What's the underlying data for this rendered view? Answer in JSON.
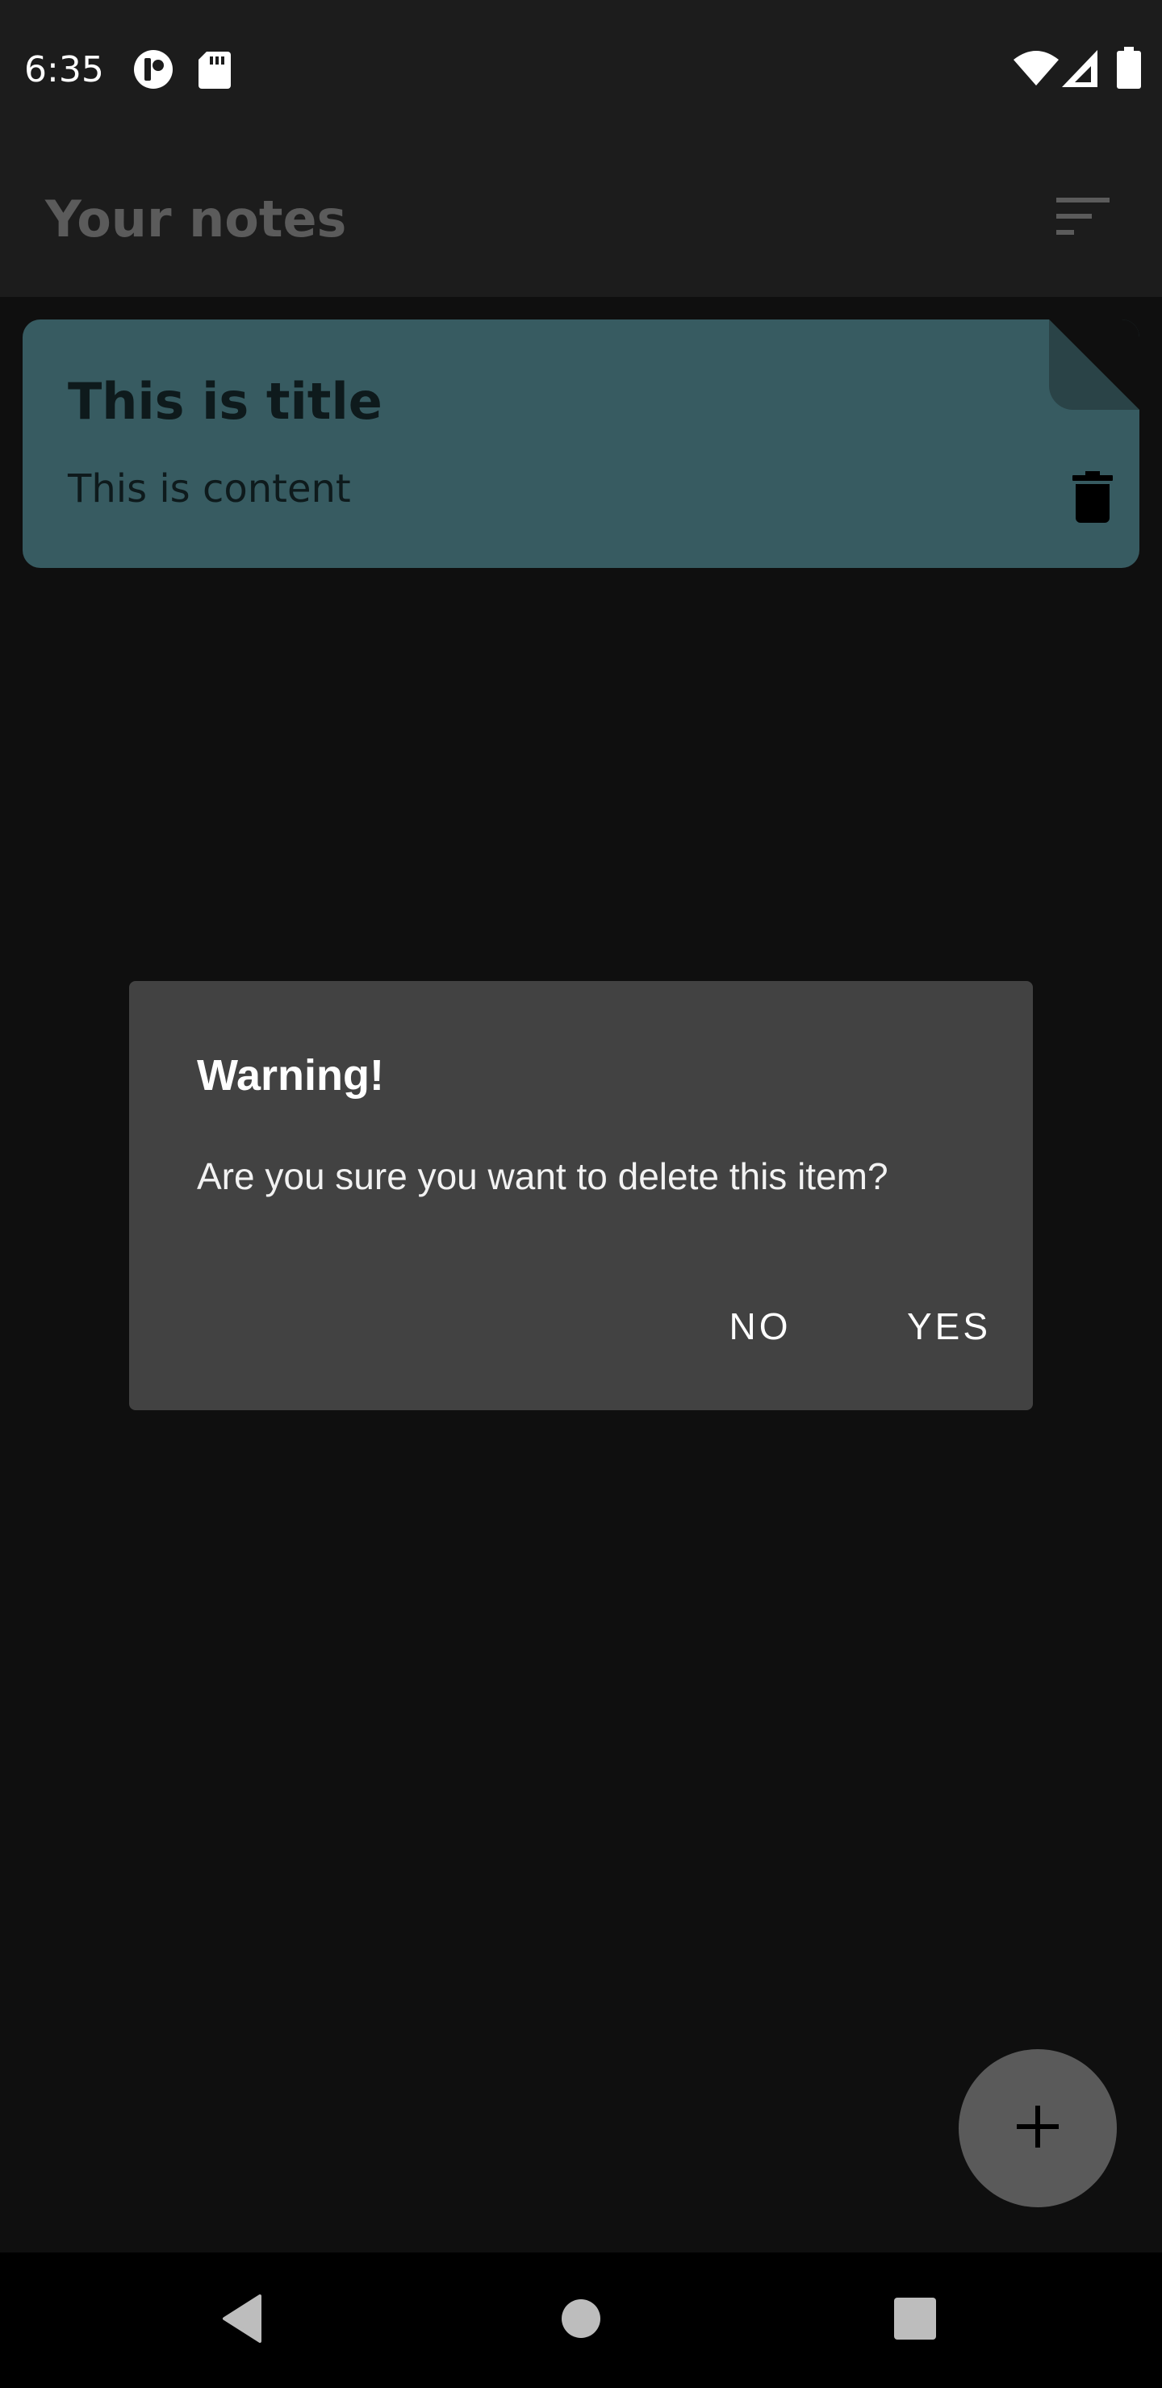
{
  "status_bar": {
    "time": "6:35",
    "icons": [
      "app-notification-icon",
      "sd-card-icon",
      "wifi-icon",
      "cell-signal-icon",
      "battery-icon"
    ]
  },
  "app_bar": {
    "title": "Your notes",
    "sort_icon": "sort-icon"
  },
  "notes": [
    {
      "title": "This is title",
      "content": "This is content",
      "color": "#375b61",
      "delete_icon": "trash-icon"
    }
  ],
  "dialog": {
    "title": "Warning!",
    "message": "Are you sure you want to delete this item?",
    "negative_label": "NO",
    "positive_label": "YES"
  },
  "fab": {
    "icon": "plus-icon"
  },
  "nav_bar": {
    "icons": [
      "back-icon",
      "home-icon",
      "recents-icon"
    ]
  },
  "colors": {
    "background": "#0f0f0f",
    "bar": "#1c1c1c",
    "dialog": "#424242",
    "note": "#375b61"
  }
}
